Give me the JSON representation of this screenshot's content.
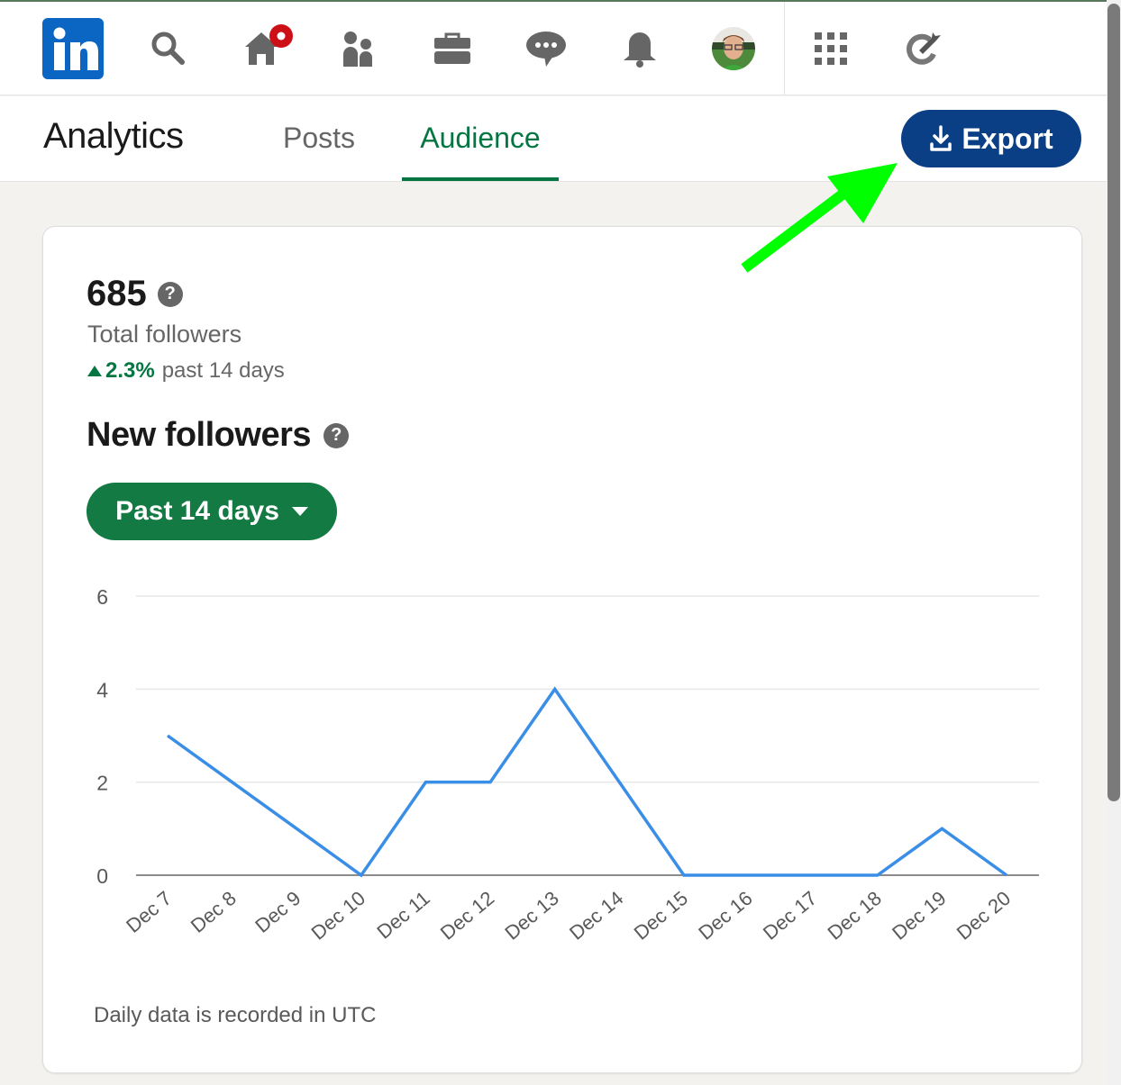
{
  "nav": {
    "icons": [
      "linkedin-logo",
      "search-icon",
      "home-icon",
      "my-network-icon",
      "jobs-icon",
      "messaging-icon",
      "notifications-icon",
      "profile-avatar",
      "apps-grid-icon",
      "advertise-icon"
    ],
    "logo_text": "in"
  },
  "header": {
    "title": "Analytics",
    "tabs": [
      {
        "label": "Posts",
        "active": false
      },
      {
        "label": "Audience",
        "active": true
      }
    ],
    "export_label": "Export"
  },
  "summary": {
    "total_value": "685",
    "total_label": "Total followers",
    "trend_value": "2.3%",
    "trend_text": "past 14 days",
    "help_glyph": "?"
  },
  "new_followers": {
    "title": "New followers",
    "range_label": "Past 14 days",
    "footnote": "Daily data is recorded in UTC"
  },
  "colors": {
    "brand": "#0a66c2",
    "accent_green": "#057642",
    "export_blue": "#0a3e85",
    "line": "#3a8ee6",
    "annotation": "#00ff00"
  },
  "chart_data": {
    "type": "line",
    "title": "New followers",
    "xlabel": "",
    "ylabel": "",
    "categories": [
      "Dec 7",
      "Dec 8",
      "Dec 9",
      "Dec 10",
      "Dec 11",
      "Dec 12",
      "Dec 13",
      "Dec 14",
      "Dec 15",
      "Dec 16",
      "Dec 17",
      "Dec 18",
      "Dec 19",
      "Dec 20"
    ],
    "series": [
      {
        "name": "New followers",
        "values": [
          3,
          2,
          1,
          0,
          2,
          2,
          4,
          2,
          0,
          0,
          0,
          0,
          1,
          0
        ]
      }
    ],
    "ylim": [
      0,
      6
    ],
    "yticks": [
      "0",
      "2",
      "4",
      "6"
    ],
    "grid": true,
    "legend": "none"
  }
}
